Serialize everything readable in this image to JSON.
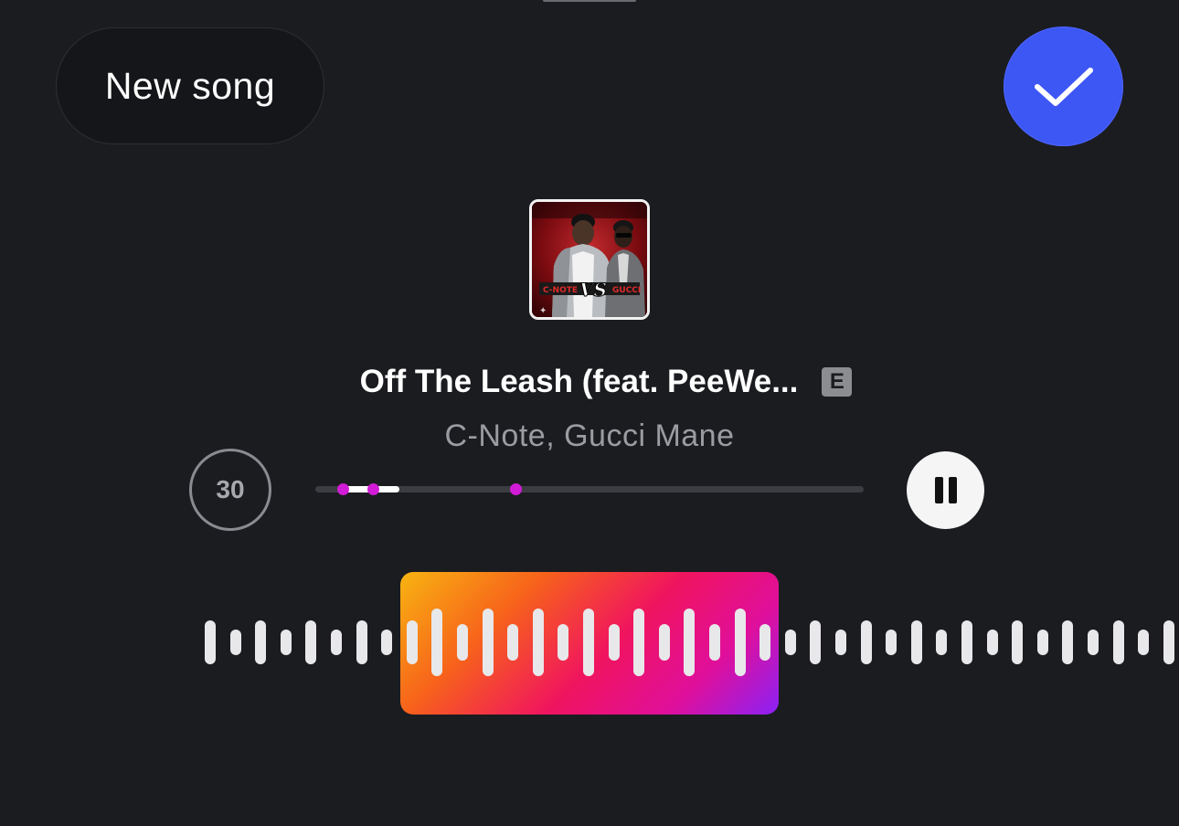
{
  "header": {
    "new_song_label": "New song",
    "done_icon": "checkmark-icon",
    "accent_color": "#3d57f5"
  },
  "track": {
    "title": "Off The Leash (feat. PeeWe...",
    "explicit_label": "E",
    "artist": "C-Note, Gucci Mane",
    "album_art_text": "C-NOTE VS GUCCI"
  },
  "player": {
    "clip_duration": "30",
    "progress_fraction": 0.1,
    "markers": [
      0.05,
      0.105,
      0.365
    ],
    "pause_icon": "pause-icon",
    "marker_color": "#d11bd6"
  },
  "waveform": {
    "clip_gradient": [
      "#f8b411",
      "#f7621b",
      "#f0145f",
      "#e00f9a",
      "#8b22f6"
    ]
  }
}
